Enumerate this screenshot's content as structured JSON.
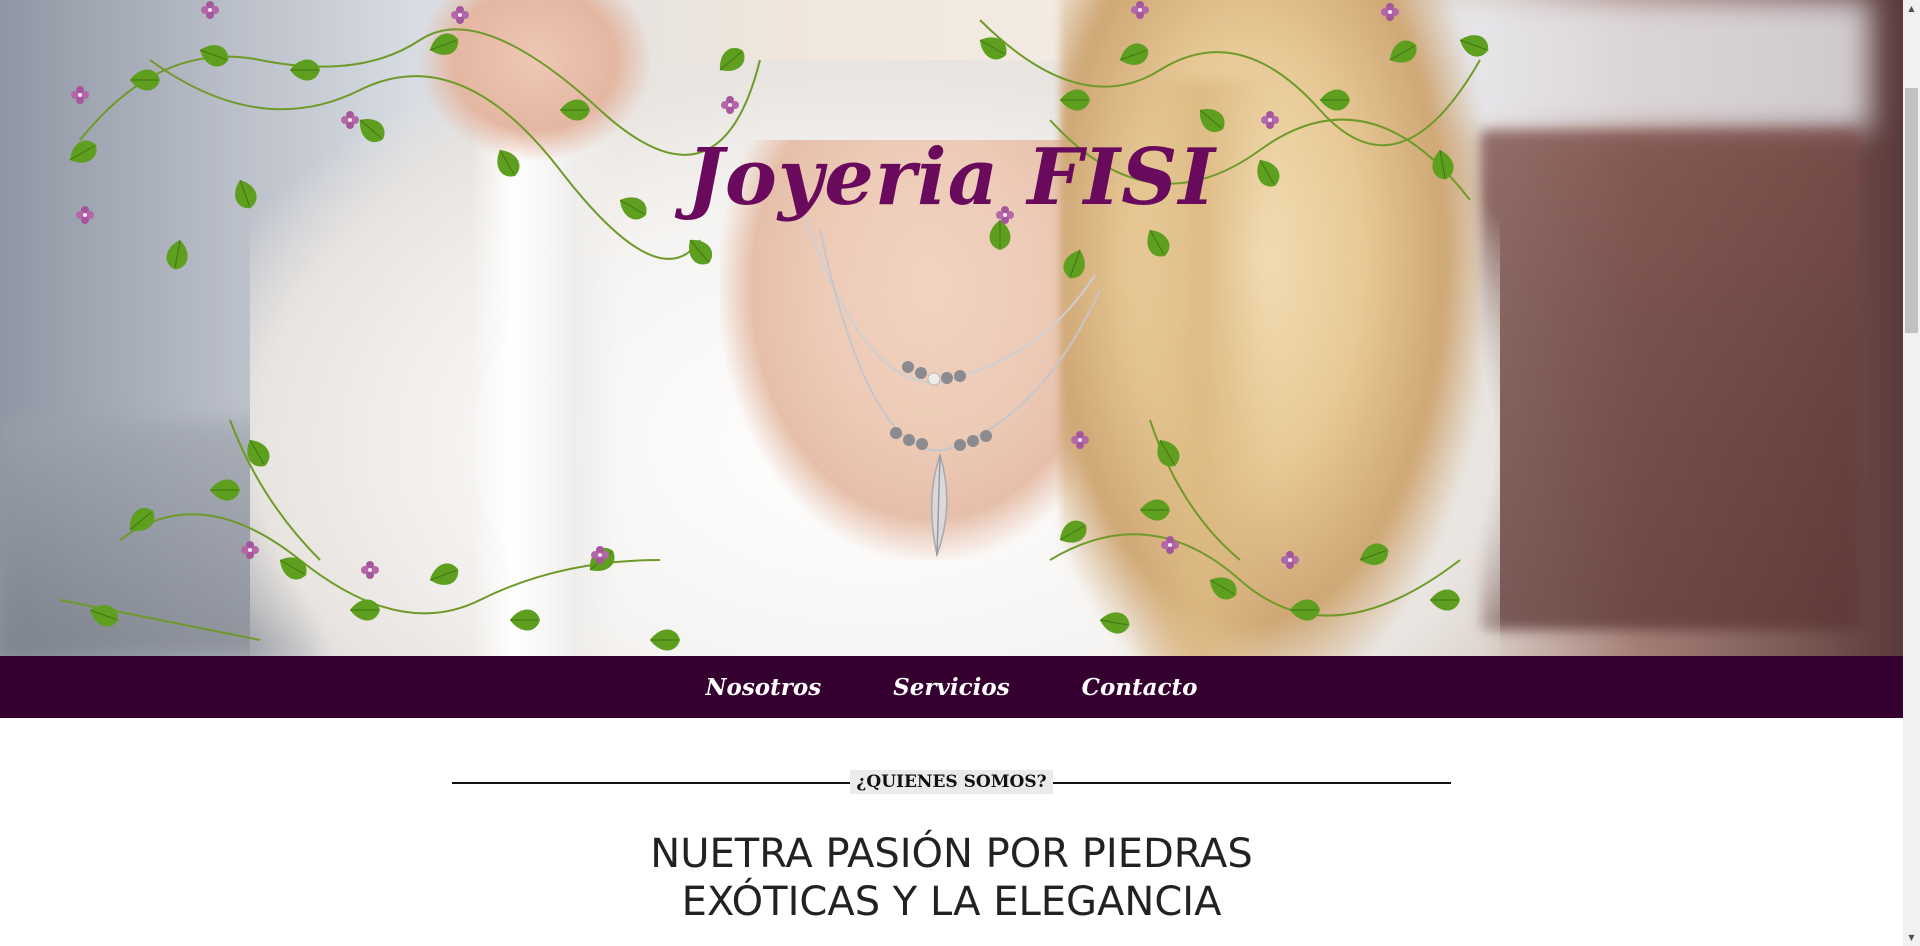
{
  "header": {
    "site_title": "Joyeria FISI"
  },
  "nav": {
    "items": [
      {
        "label": "Nosotros"
      },
      {
        "label": "Servicios"
      },
      {
        "label": "Contacto"
      }
    ]
  },
  "about": {
    "section_label": "¿QUIENES SOMOS?",
    "headline_line1": "NUETRA PASIÓN POR PIEDRAS",
    "headline_line2": "EXÓTICAS Y LA ELEGANCIA"
  },
  "icons": {
    "scroll_up": "triangle-up",
    "scroll_down": "triangle-down"
  },
  "colors": {
    "brand_title": "#6a0a5d",
    "nav_background": "#35002f",
    "nav_text": "#ffffff",
    "section_pill": "#ebebeb",
    "headline_text": "#222222"
  }
}
